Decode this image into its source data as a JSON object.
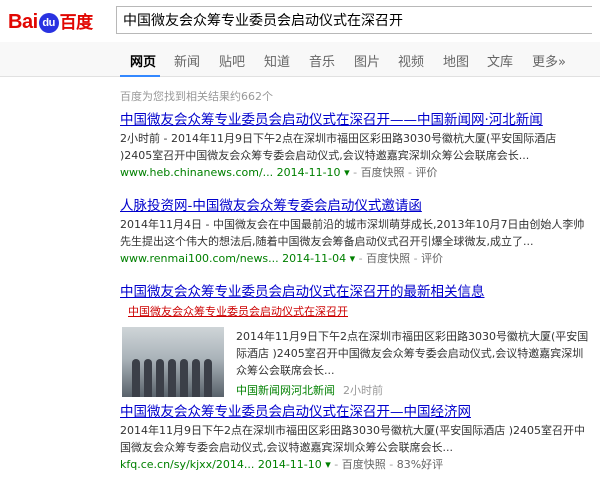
{
  "logo": {
    "left": "Bai",
    "paw": "du",
    "cn": "百度"
  },
  "search": {
    "query": "中国微友会众筹专业委员会启动仪式在深召开"
  },
  "nav": {
    "tabs": [
      "网页",
      "新闻",
      "贴吧",
      "知道",
      "音乐",
      "图片",
      "视频",
      "地图",
      "文库",
      "更多»"
    ]
  },
  "result_count": "百度为您找到相关结果约662个",
  "results": [
    {
      "title": "中国微友会众筹专业委员会启动仪式在深召开——中国新闻网·河北新闻",
      "abstract": "2小时前 - 2014年11月9日下午2点在深圳市福田区彩田路3030号徽杭大厦(平安国际酒店 )2405室召开中国微友会众筹专委会启动仪式,会议特邀嘉宾深圳众筹公会联席会长...",
      "url": "www.heb.chinanews.com/...  2014-11-10",
      "snapshot": "百度快照",
      "rate": "评价"
    },
    {
      "title": "人脉投资网-中国微友会众筹专委会启动仪式邀请函",
      "abstract": "2014年11月4日 - 中国微友会在中国最前沿的城市深圳萌芽成长,2013年10月7日由创始人李帅先生提出这个伟大的想法后,随着中国微友会筹备启动仪式召开引爆全球微友,成立了...",
      "url": "www.renmai100.com/news...  2014-11-04",
      "snapshot": "百度快照",
      "rate": "评价"
    },
    {
      "title": "中国微友会众筹专业委员会启动仪式在深召开的最新相关信息",
      "sub_title": "中国微友会众筹专业委员会启动仪式在深召开",
      "sub_body": "2014年11月9日下午2点在深圳市福田区彩田路3030号徽杭大厦(平安国际酒店 )2405室召开中国微友会众筹专委会启动仪式,会议特邀嘉宾深圳众筹公会联席会长...",
      "sub_source": "中国新闻网河北新闻",
      "sub_time": "2小时前"
    },
    {
      "title": "中国微友会众筹专业委员会启动仪式在深召开—中国经济网",
      "abstract": "2014年11月9日下午2点在深圳市福田区彩田路3030号徽杭大厦(平安国际酒店 )2405室召开中国微友会众筹专委会启动仪式,会议特邀嘉宾深圳众筹公会联席会长...",
      "url": "kfq.ce.cn/sy/kjxx/2014...  2014-11-10",
      "snapshot": "百度快照",
      "rate": "83%好评"
    }
  ]
}
